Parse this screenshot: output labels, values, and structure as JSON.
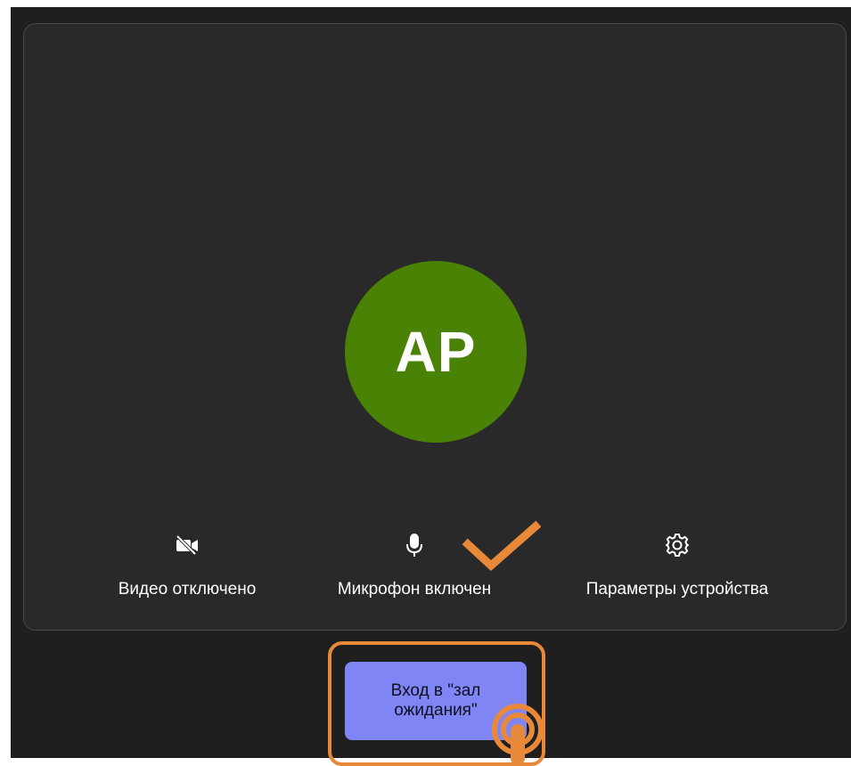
{
  "avatar": {
    "initials": "AP",
    "color": "#498205"
  },
  "controls": {
    "video": {
      "label": "Видео отключено",
      "icon": "video-off-icon"
    },
    "microphone": {
      "label": "Микрофон включен",
      "icon": "microphone-icon"
    },
    "settings": {
      "label": "Параметры устройства",
      "icon": "gear-icon"
    }
  },
  "join_button": {
    "label": "Вход в \"зал ожидания\"",
    "color": "#7f85f5"
  },
  "annotations": {
    "highlight_color": "#e8893a",
    "checkmark_icon": "checkmark-icon",
    "tap_icon": "tap-gesture-icon"
  }
}
